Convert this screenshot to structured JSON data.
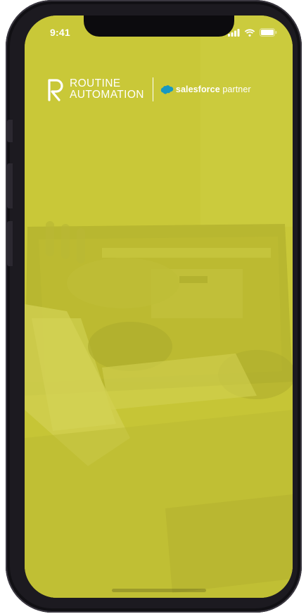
{
  "status_bar": {
    "time": "9:41",
    "icons": [
      "cellular-signal-icon",
      "wifi-icon",
      "battery-icon"
    ]
  },
  "branding": {
    "company_line1": "ROUTINE",
    "company_line2": "AUTOMATION",
    "partner_brand": "salesforce",
    "partner_suffix": " partner"
  },
  "colors": {
    "overlay": "#c9c838",
    "text": "#ffffff",
    "frame": "#1c1a20"
  }
}
